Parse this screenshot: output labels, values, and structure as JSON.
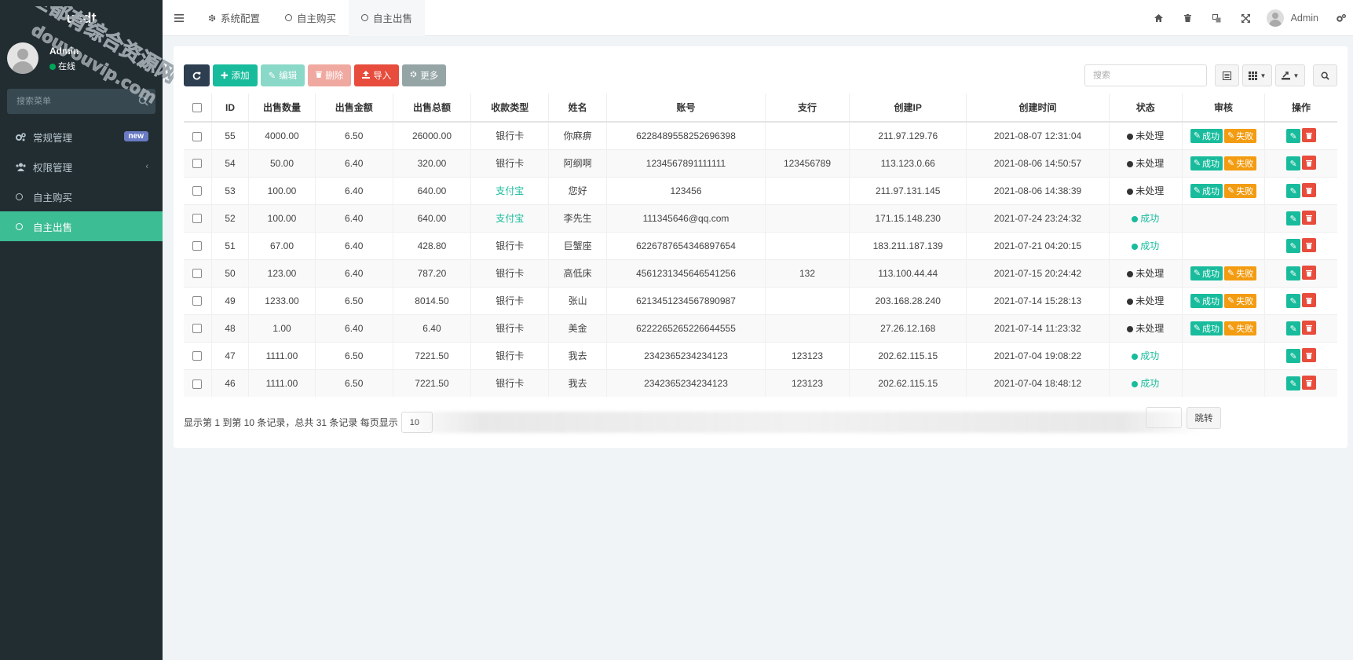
{
  "app": {
    "brand": "usdt"
  },
  "user": {
    "name": "Admin",
    "status": "在线"
  },
  "sidebar": {
    "search_placeholder": "搜索菜单",
    "items": [
      {
        "label": "常规管理",
        "icon": "cogs-icon",
        "badge": "new"
      },
      {
        "label": "权限管理",
        "icon": "users-icon"
      },
      {
        "label": "自主购买",
        "icon": "circle-icon"
      },
      {
        "label": "自主出售",
        "icon": "circle-icon",
        "active": true
      }
    ]
  },
  "topbar": {
    "tabs": [
      {
        "label": "系统配置",
        "icon": "gear-icon"
      },
      {
        "label": "自主购买",
        "icon": "circle-icon"
      },
      {
        "label": "自主出售",
        "icon": "circle-icon",
        "active": true
      }
    ],
    "user_name": "Admin"
  },
  "toolbar": {
    "add": "添加",
    "edit": "编辑",
    "delete": "删除",
    "import": "导入",
    "more": "更多",
    "search_placeholder": "搜索"
  },
  "table": {
    "headers": [
      "ID",
      "出售数量",
      "出售金额",
      "出售总额",
      "收款类型",
      "姓名",
      "账号",
      "支行",
      "创建IP",
      "创建时间",
      "状态",
      "审核",
      "操作"
    ],
    "rows": [
      {
        "id": "55",
        "qty": "4000.00",
        "price": "6.50",
        "total": "26000.00",
        "type": "银行卡",
        "name": "你麻痹",
        "account": "6228489558252696398",
        "branch": "",
        "ip": "211.97.129.76",
        "time": "2021-08-07 12:31:04",
        "status": "未处理"
      },
      {
        "id": "54",
        "qty": "50.00",
        "price": "6.40",
        "total": "320.00",
        "type": "银行卡",
        "name": "阿纲啊",
        "account": "1234567891111111",
        "branch": "123456789",
        "ip": "113.123.0.66",
        "time": "2021-08-06 14:50:57",
        "status": "未处理"
      },
      {
        "id": "53",
        "qty": "100.00",
        "price": "6.40",
        "total": "640.00",
        "type": "支付宝",
        "name": "您好",
        "account": "123456",
        "branch": "",
        "ip": "211.97.131.145",
        "time": "2021-08-06 14:38:39",
        "status": "未处理"
      },
      {
        "id": "52",
        "qty": "100.00",
        "price": "6.40",
        "total": "640.00",
        "type": "支付宝",
        "name": "李先生",
        "account": "111345646@qq.com",
        "branch": "",
        "ip": "171.15.148.230",
        "time": "2021-07-24 23:24:32",
        "status": "成功"
      },
      {
        "id": "51",
        "qty": "67.00",
        "price": "6.40",
        "total": "428.80",
        "type": "银行卡",
        "name": "巨蟹座",
        "account": "6226787654346897654",
        "branch": "",
        "ip": "183.211.187.139",
        "time": "2021-07-21 04:20:15",
        "status": "成功"
      },
      {
        "id": "50",
        "qty": "123.00",
        "price": "6.40",
        "total": "787.20",
        "type": "银行卡",
        "name": "高低床",
        "account": "4561231345646541256",
        "branch": "132",
        "ip": "113.100.44.44",
        "time": "2021-07-15 20:24:42",
        "status": "未处理"
      },
      {
        "id": "49",
        "qty": "1233.00",
        "price": "6.50",
        "total": "8014.50",
        "type": "银行卡",
        "name": "张山",
        "account": "6213451234567890987",
        "branch": "",
        "ip": "203.168.28.240",
        "time": "2021-07-14 15:28:13",
        "status": "未处理"
      },
      {
        "id": "48",
        "qty": "1.00",
        "price": "6.40",
        "total": "6.40",
        "type": "银行卡",
        "name": "美金",
        "account": "6222265265226644555",
        "branch": "",
        "ip": "27.26.12.168",
        "time": "2021-07-14 11:23:32",
        "status": "未处理"
      },
      {
        "id": "47",
        "qty": "1111.00",
        "price": "6.50",
        "total": "7221.50",
        "type": "银行卡",
        "name": "我去",
        "account": "2342365234234123",
        "branch": "123123",
        "ip": "202.62.115.15",
        "time": "2021-07-04 19:08:22",
        "status": "成功"
      },
      {
        "id": "46",
        "qty": "1111.00",
        "price": "6.50",
        "total": "7221.50",
        "type": "银行卡",
        "name": "我去",
        "account": "2342365234234123",
        "branch": "123123",
        "ip": "202.62.115.15",
        "time": "2021-07-04 18:48:12",
        "status": "成功"
      }
    ],
    "audit_ok": "成功",
    "audit_fail": "失败"
  },
  "pager": {
    "info": "显示第 1 到第 10 条记录，总共 31 条记录 每页显示",
    "page_size": "10",
    "jump": "跳转"
  },
  "watermark": {
    "line1": "全都有综合资源网",
    "line2": "douyouvip.com"
  },
  "colors": {
    "sidebar": "#222d32",
    "accent": "#3dbd93",
    "success": "#18bc9c",
    "danger": "#e74c3c",
    "warning": "#f39c12"
  }
}
